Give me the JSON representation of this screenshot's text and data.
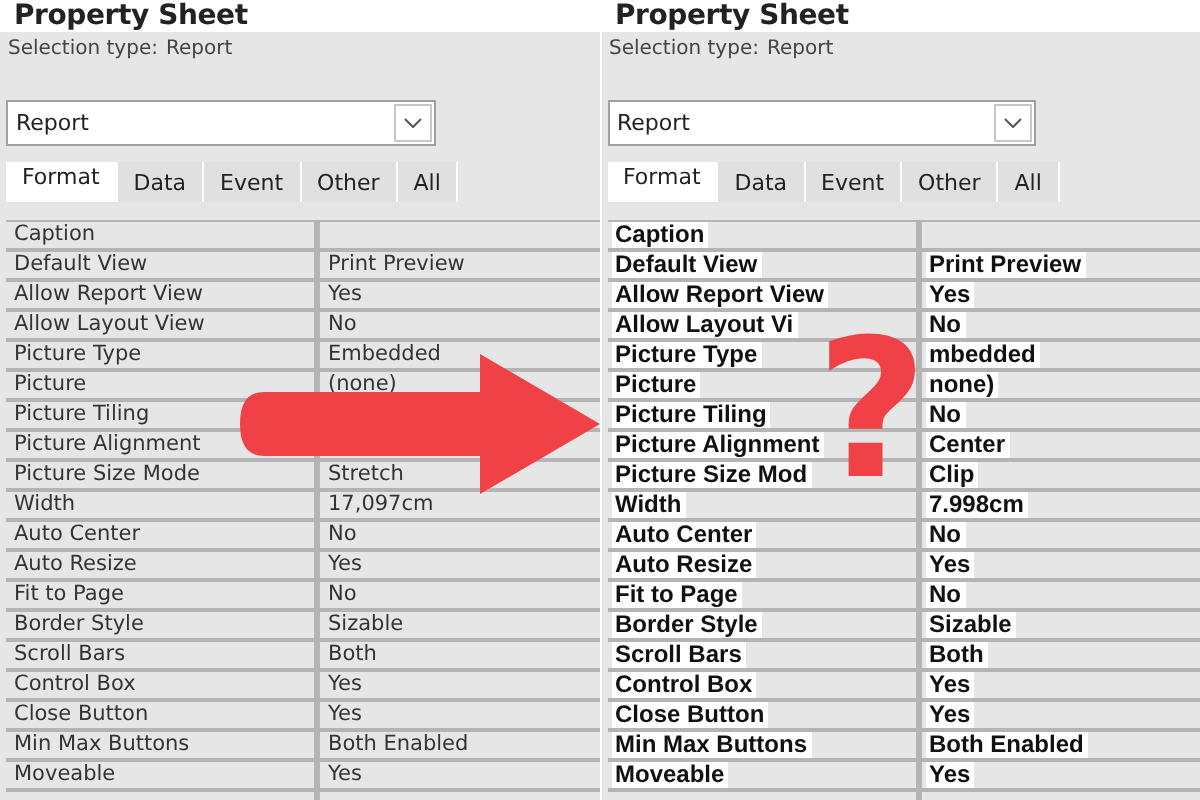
{
  "panels": [
    {
      "kind": "modern",
      "title": "Property Sheet",
      "selection_type_label": "Selection type:",
      "selection_type_value": "Report",
      "object_dropdown": {
        "value": "Report"
      },
      "tabs": [
        {
          "label": "Format",
          "selected": true
        },
        {
          "label": "Data",
          "selected": false
        },
        {
          "label": "Event",
          "selected": false
        },
        {
          "label": "Other",
          "selected": false
        },
        {
          "label": "All",
          "selected": false
        }
      ],
      "properties": [
        {
          "name": "Caption"
        },
        {
          "name": "Default View",
          "value": "Print Preview"
        },
        {
          "name": "Allow Report View",
          "value": "Yes"
        },
        {
          "name": "Allow Layout View",
          "value": "No"
        },
        {
          "name": "Picture Type",
          "value": "Embedded"
        },
        {
          "name": "Picture",
          "value": "(none)"
        },
        {
          "name": "Picture Tiling"
        },
        {
          "name": "Picture Alignment"
        },
        {
          "name": "Picture Size Mode",
          "value": "Stretch"
        },
        {
          "name": "Width",
          "value": "17,097cm"
        },
        {
          "name": "Auto Center",
          "value": "No"
        },
        {
          "name": "Auto Resize",
          "value": "Yes"
        },
        {
          "name": "Fit to Page",
          "value": "No"
        },
        {
          "name": "Border Style",
          "value": "Sizable"
        },
        {
          "name": "Scroll Bars",
          "value": "Both"
        },
        {
          "name": "Control Box",
          "value": "Yes"
        },
        {
          "name": "Close Button",
          "value": "Yes"
        },
        {
          "name": "Min Max Buttons",
          "value": "Both Enabled"
        },
        {
          "name": "Moveable",
          "value": "Yes"
        }
      ]
    },
    {
      "kind": "classic",
      "title": "Property Sheet",
      "selection_type_label": "Selection type:",
      "selection_type_value": "Report",
      "object_dropdown": {
        "value": "Report"
      },
      "tabs": [
        {
          "label": "Format",
          "selected": true
        },
        {
          "label": "Data",
          "selected": false
        },
        {
          "label": "Event",
          "selected": false
        },
        {
          "label": "Other",
          "selected": false
        },
        {
          "label": "All",
          "selected": false
        }
      ],
      "properties": [
        {
          "name": "Caption"
        },
        {
          "name": "Default View",
          "value": "Print Preview"
        },
        {
          "name": "Allow Report View",
          "value": "Yes"
        },
        {
          "name": "Allow Layout Vi",
          "value": "No"
        },
        {
          "name": "Picture Type",
          "value": "mbedded"
        },
        {
          "name": "Picture",
          "value": "none)"
        },
        {
          "name": "Picture Tiling",
          "value": "No"
        },
        {
          "name": "Picture Alignment",
          "value": "Center"
        },
        {
          "name": "Picture Size Mod",
          "value": "Clip"
        },
        {
          "name": "Width",
          "value": "7.998cm"
        },
        {
          "name": "Auto Center",
          "value": "No"
        },
        {
          "name": "Auto Resize",
          "value": "Yes"
        },
        {
          "name": "Fit to Page",
          "value": "No"
        },
        {
          "name": "Border Style",
          "value": "Sizable"
        },
        {
          "name": "Scroll Bars",
          "value": "Both"
        },
        {
          "name": "Control Box",
          "value": "Yes"
        },
        {
          "name": "Close Button",
          "value": "Yes"
        },
        {
          "name": "Min Max Buttons",
          "value": "Both Enabled"
        },
        {
          "name": "Moveable",
          "value": "Yes"
        }
      ]
    }
  ],
  "question_mark": "?"
}
